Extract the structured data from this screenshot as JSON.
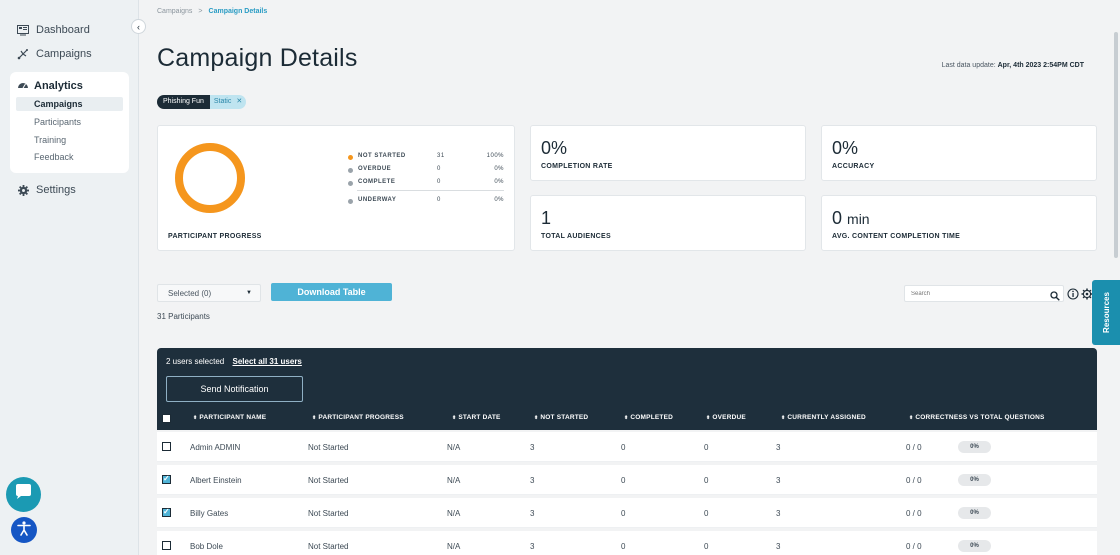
{
  "sidebar": {
    "items": [
      {
        "label": "Dashboard",
        "icon": "dashboard-icon"
      },
      {
        "label": "Campaigns",
        "icon": "campaigns-icon"
      }
    ],
    "analytics": {
      "label": "Analytics",
      "icon": "gauge-icon",
      "subitems": [
        {
          "label": "Campaigns",
          "active": true
        },
        {
          "label": "Participants"
        },
        {
          "label": "Training"
        },
        {
          "label": "Feedback"
        }
      ]
    },
    "settings": {
      "label": "Settings",
      "icon": "gear-icon"
    }
  },
  "breadcrumb": {
    "parent": "Campaigns",
    "current": "Campaign Details"
  },
  "page": {
    "title": "Campaign Details",
    "last_update_label": "Last data update:",
    "last_update_value": "Apr, 4th 2023 2:54PM CDT"
  },
  "tag": {
    "name": "Phishing Fun",
    "type": "Static"
  },
  "progress_card": {
    "label": "PARTICIPANT PROGRESS",
    "legend": [
      {
        "name": "NOT STARTED",
        "count": "31",
        "pct": "100%",
        "color": "#f5961d"
      },
      {
        "name": "OVERDUE",
        "count": "0",
        "pct": "0%",
        "color": "#9aa3aa"
      },
      {
        "name": "COMPLETE",
        "count": "0",
        "pct": "0%",
        "color": "#9aa3aa"
      },
      {
        "name": "UNDERWAY",
        "count": "0",
        "pct": "0%",
        "color": "#9aa3aa"
      }
    ]
  },
  "stats": {
    "completion_rate": {
      "value": "0%",
      "label": "COMPLETION RATE"
    },
    "accuracy": {
      "value": "0%",
      "label": "ACCURACY"
    },
    "total_audiences": {
      "value": "1",
      "label": "TOTAL AUDIENCES"
    },
    "avg_time": {
      "value": "0",
      "unit": "min",
      "label": "AVG. CONTENT COMPLETION TIME"
    }
  },
  "toolbar": {
    "selected_label": "Selected (0)",
    "download_label": "Download Table",
    "participants_count": "31 Participants",
    "search_placeholder": "Search"
  },
  "resources_label": "Resources",
  "table": {
    "selection_text": "2 users selected",
    "select_all_text": "Select all 31 users",
    "send_label": "Send Notification",
    "headers": [
      "PARTICIPANT NAME",
      "PARTICIPANT PROGRESS",
      "START DATE",
      "NOT STARTED",
      "COMPLETED",
      "OVERDUE",
      "CURRENTLY ASSIGNED",
      "CORRECTNESS VS TOTAL QUESTIONS"
    ],
    "rows": [
      {
        "checked": false,
        "name": "Admin ADMIN",
        "progress": "Not Started",
        "start": "N/A",
        "not_started": "3",
        "completed": "0",
        "overdue": "0",
        "assigned": "3",
        "correct": "0 / 0",
        "pct": "0%"
      },
      {
        "checked": true,
        "name": "Albert Einstein",
        "progress": "Not Started",
        "start": "N/A",
        "not_started": "3",
        "completed": "0",
        "overdue": "0",
        "assigned": "3",
        "correct": "0 / 0",
        "pct": "0%"
      },
      {
        "checked": true,
        "name": "Billy Gates",
        "progress": "Not Started",
        "start": "N/A",
        "not_started": "3",
        "completed": "0",
        "overdue": "0",
        "assigned": "3",
        "correct": "0 / 0",
        "pct": "0%"
      },
      {
        "checked": false,
        "name": "Bob Dole",
        "progress": "Not Started",
        "start": "N/A",
        "not_started": "3",
        "completed": "0",
        "overdue": "0",
        "assigned": "3",
        "correct": "0 / 0",
        "pct": "0%"
      }
    ]
  },
  "colors": {
    "accent": "#4fb3d6",
    "header_dark": "#1e2f3c",
    "ring": "#f5961d"
  }
}
